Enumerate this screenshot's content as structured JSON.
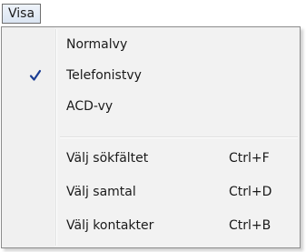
{
  "menu_bar": {
    "title": "Visa"
  },
  "dropdown": {
    "view_items": [
      {
        "label": "Normalvy",
        "checked": false
      },
      {
        "label": "Telefonistvy",
        "checked": true
      },
      {
        "label": "ACD-vy",
        "checked": false
      }
    ],
    "action_items": [
      {
        "label": "Välj sökfältet",
        "shortcut": "Ctrl+F"
      },
      {
        "label": "Välj samtal",
        "shortcut": "Ctrl+D"
      },
      {
        "label": "Välj kontakter",
        "shortcut": "Ctrl+B"
      }
    ],
    "check_icon": "checkmark-icon",
    "check_color": "#1b3d93"
  }
}
